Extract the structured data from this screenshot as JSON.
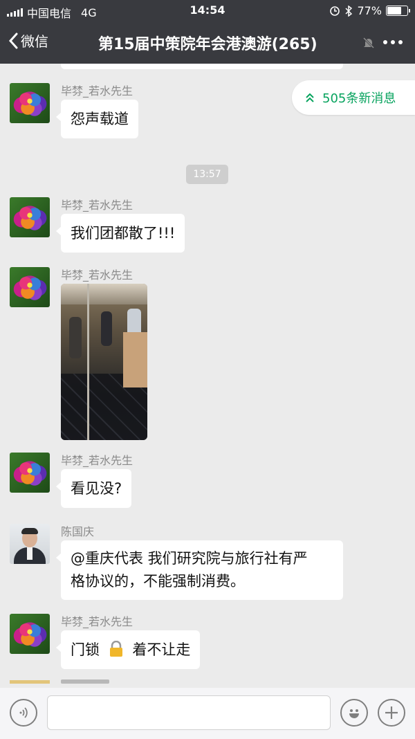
{
  "status_bar": {
    "carrier": "中国电信",
    "network": "4G",
    "time": "14:54",
    "battery": "77%",
    "battery_level": 0.77
  },
  "nav": {
    "back_label": "微信",
    "title": "第15届中策院年会港澳游(265)"
  },
  "new_messages": "505条新消息",
  "time_divider": "13:57",
  "messages": [
    {
      "sender": "毕棼_若水先生",
      "text": "怨声载道",
      "avatar": "rose-avatar"
    },
    {
      "sender": "毕棼_若水先生",
      "text": "我们团都散了!!!",
      "avatar": "rose-avatar"
    },
    {
      "sender": "毕棼_若水先生",
      "image": "lobby-photo",
      "avatar": "rose-avatar"
    },
    {
      "sender": "毕棼_若水先生",
      "text": "看见没?",
      "avatar": "rose-avatar"
    },
    {
      "sender": "陈国庆",
      "text_line1": "@重庆代表 我们研究院与旅行社有严",
      "text_line2": "格协议的，不能强制消费。",
      "avatar": "person-avatar"
    },
    {
      "sender": "毕棼_若水先生",
      "text_before": "门锁",
      "text_after": "着不让走",
      "avatar": "rose-avatar"
    }
  ],
  "colors": {
    "header_bg": "#393a3f",
    "chat_bg": "#ebebeb",
    "accent_green": "#07a35e"
  },
  "icons": [
    "signal-icon",
    "alarm-lock-icon",
    "bluetooth-icon",
    "battery-icon",
    "back-chevron-icon",
    "mute-bell-icon",
    "more-dots-icon",
    "double-chevron-up-icon",
    "lock-emoji-icon",
    "voice-icon",
    "emoji-icon",
    "plus-icon"
  ]
}
